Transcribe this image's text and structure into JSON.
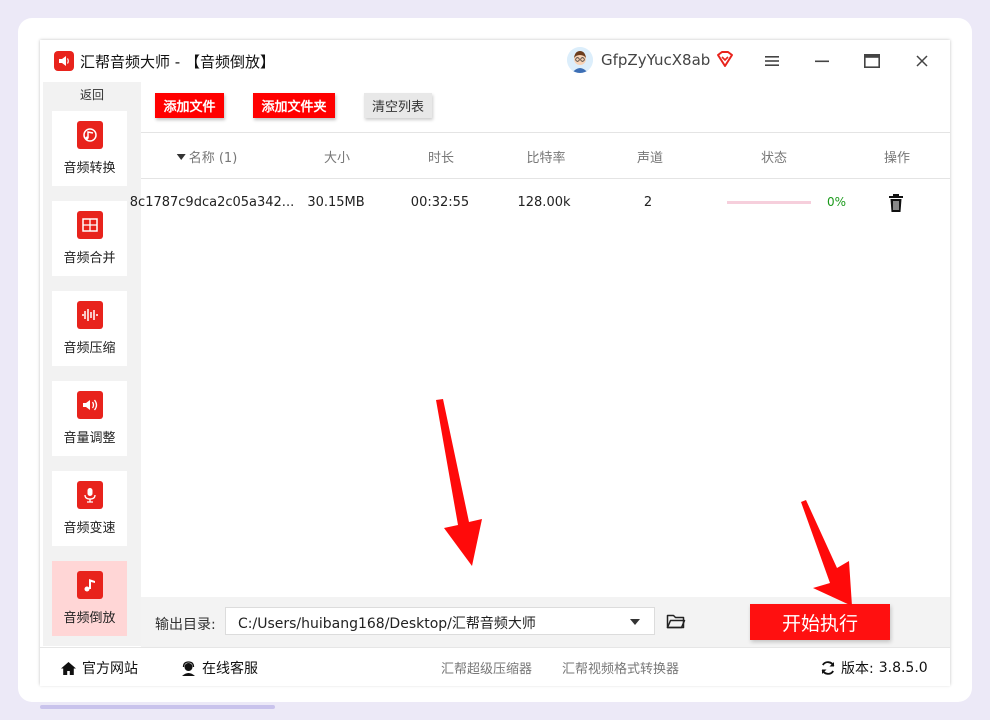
{
  "titlebar": {
    "app_name": "汇帮音频大师",
    "separator": " - ",
    "page_title": "【音频倒放】",
    "username": "GfpZyYucX8ab",
    "menu_icon": "menu-icon",
    "minimize_icon": "minimize-icon",
    "maximize_icon": "maximize-icon",
    "close_icon": "close-icon"
  },
  "sidebar": {
    "back_label": "返回",
    "items": [
      {
        "label": "音频转换",
        "icon": "audio-convert-icon"
      },
      {
        "label": "音频合并",
        "icon": "audio-merge-icon"
      },
      {
        "label": "音频压缩",
        "icon": "audio-compress-icon"
      },
      {
        "label": "音量调整",
        "icon": "volume-adjust-icon"
      },
      {
        "label": "音频变速",
        "icon": "audio-speed-icon"
      },
      {
        "label": "音频倒放",
        "icon": "audio-reverse-icon",
        "active": true
      }
    ]
  },
  "toolbar": {
    "add_file": "添加文件",
    "add_folder": "添加文件夹",
    "clear_list": "清空列表"
  },
  "table": {
    "headers": {
      "name": "名称 (1)",
      "size": "大小",
      "duration": "时长",
      "bitrate": "比特率",
      "channels": "声道",
      "status": "状态",
      "action": "操作"
    },
    "rows": [
      {
        "name": "8c1787c9dca2c05a342...",
        "size": "30.15MB",
        "duration": "00:32:55",
        "bitrate": "128.00k",
        "channels": "2",
        "progress": 0,
        "progress_text": "0%"
      }
    ]
  },
  "output": {
    "label": "输出目录:",
    "path": "C:/Users/huibang168/Desktop/汇帮音频大师",
    "start_label": "开始执行"
  },
  "footer": {
    "website": "官方网站",
    "support": "在线客服",
    "link1": "汇帮超级压缩器",
    "link2": "汇帮视频格式转换器",
    "version_label": "版本:",
    "version": "3.8.5.0"
  },
  "colors": {
    "accent": "#ff0000",
    "progress_track": "#f6cfdc",
    "percent_text": "#1a9a1a",
    "active_nav_bg": "#ffd6d6"
  }
}
